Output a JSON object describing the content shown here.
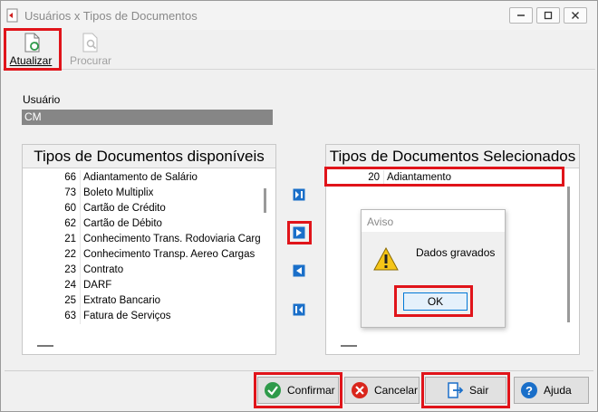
{
  "window": {
    "title": "Usuários x Tipos de Documentos"
  },
  "toolbar": {
    "refresh_label": "Atualizar",
    "search_label": "Procurar"
  },
  "user": {
    "label": "Usuário",
    "value": "CM"
  },
  "available": {
    "header": "Tipos de Documentos disponíveis",
    "rows": [
      {
        "code": "66",
        "desc": "Adiantamento de Salário"
      },
      {
        "code": "73",
        "desc": "Boleto Multiplix"
      },
      {
        "code": "60",
        "desc": "Cartão de Crédito"
      },
      {
        "code": "62",
        "desc": "Cartão de Débito"
      },
      {
        "code": "21",
        "desc": "Conhecimento Trans. Rodoviaria Carg"
      },
      {
        "code": "22",
        "desc": "Conhecimento Transp. Aereo Cargas"
      },
      {
        "code": "23",
        "desc": "Contrato"
      },
      {
        "code": "24",
        "desc": "DARF"
      },
      {
        "code": "25",
        "desc": "Extrato Bancario"
      },
      {
        "code": "63",
        "desc": "Fatura de Serviços"
      }
    ]
  },
  "selected": {
    "header": "Tipos de Documentos Selecionados",
    "rows": [
      {
        "code": "20",
        "desc": "Adiantamento"
      }
    ]
  },
  "dialog": {
    "title": "Aviso",
    "message": "Dados gravados",
    "ok_label": "OK"
  },
  "footer": {
    "confirm_label": "Confirmar",
    "cancel_label": "Cancelar",
    "exit_label": "Sair",
    "help_label": "Ajuda"
  },
  "colors": {
    "highlight": "#e0141a",
    "accent_blue": "#1a6fc9",
    "confirm_green": "#2e9a4a",
    "cancel_red": "#d9261c"
  }
}
